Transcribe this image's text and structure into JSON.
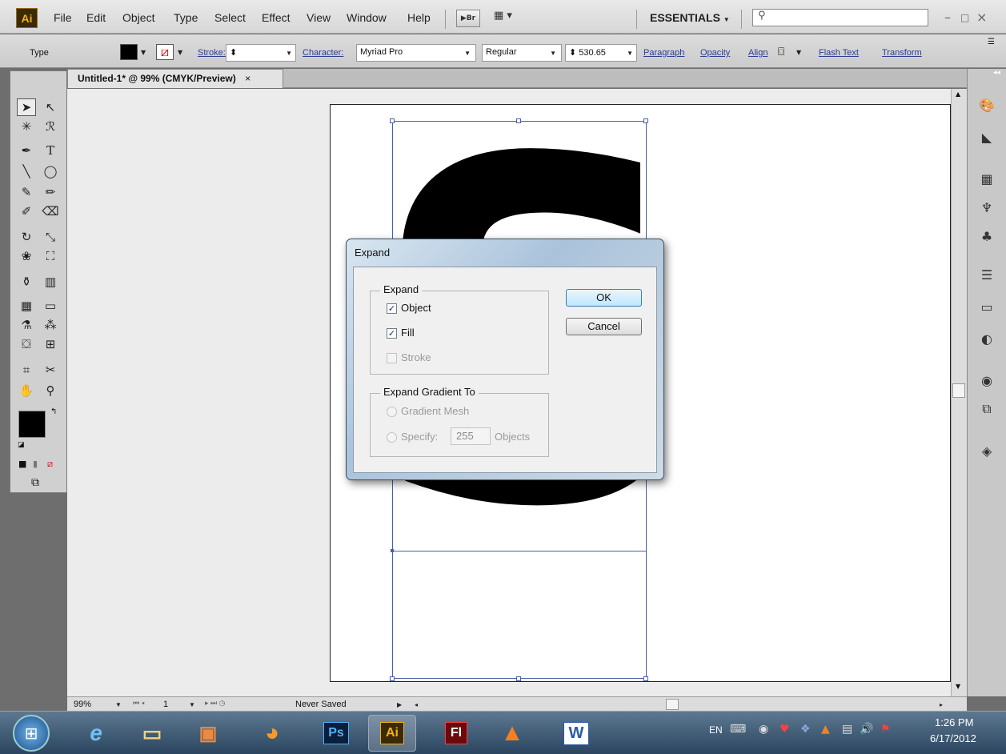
{
  "app": {
    "logo": "Ai",
    "menus": [
      "File",
      "Edit",
      "Object",
      "Type",
      "Select",
      "Effect",
      "View",
      "Window",
      "Help"
    ],
    "bridge_label": "Br",
    "workspace": "ESSENTIALS",
    "search_placeholder": ""
  },
  "control_bar": {
    "type_label": "Type",
    "stroke_label": "Stroke:",
    "character_label": "Character:",
    "font_family": "Myriad Pro",
    "font_style": "Regular",
    "font_size": "530.65",
    "paragraph": "Paragraph",
    "opacity": "Opacity",
    "align": "Align",
    "flash_text": "Flash Text",
    "transform": "Transform"
  },
  "document": {
    "tab_title": "Untitled-1* @ 99% (CMYK/Preview)",
    "glyph": "S"
  },
  "status": {
    "zoom": "99%",
    "artboard_num": "1",
    "save_state": "Never Saved"
  },
  "dialog": {
    "title": "Expand",
    "expand_group": "Expand",
    "object_label": "Object",
    "fill_label": "Fill",
    "stroke_label": "Stroke",
    "object_checked": true,
    "fill_checked": true,
    "stroke_checked": false,
    "gradient_group": "Expand Gradient To",
    "gradient_mesh_label": "Gradient Mesh",
    "specify_label": "Specify:",
    "specify_value": "255",
    "objects_label": "Objects",
    "ok_label": "OK",
    "cancel_label": "Cancel"
  },
  "taskbar": {
    "apps": [
      "start",
      "internet-explorer",
      "file-explorer",
      "media-player",
      "firefox",
      "Ps",
      "Ai",
      "Fl",
      "vlc",
      "W"
    ],
    "language": "EN",
    "time": "1:26 PM",
    "date": "6/17/2012"
  }
}
